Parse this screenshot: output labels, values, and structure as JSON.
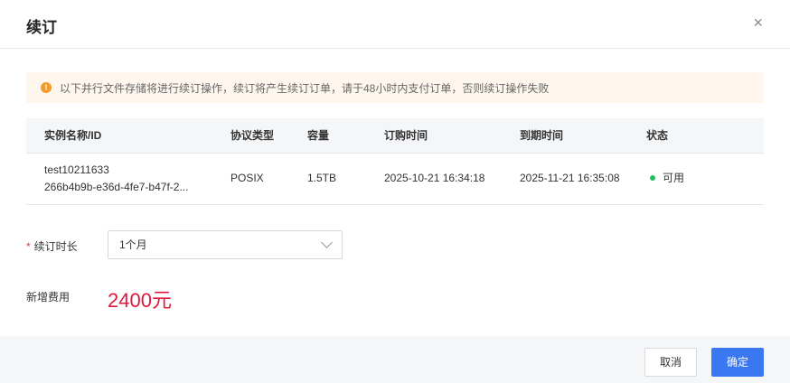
{
  "dialog": {
    "title": "续订",
    "close": "×"
  },
  "alert": {
    "icon": "!",
    "text": "以下并行文件存储将进行续订操作，续订将产生续订订单，请于48小时内支付订单，否则续订操作失败"
  },
  "table": {
    "headers": [
      "实例名称/ID",
      "协议类型",
      "容量",
      "订购时间",
      "到期时间",
      "状态"
    ],
    "rows": [
      {
        "name": "test10211633",
        "id": "266b4b9b-e36d-4fe7-b47f-2...",
        "protocol": "POSIX",
        "capacity": "1.5TB",
        "order_time": "2025-10-21 16:34:18",
        "expire_time": "2025-11-21 16:35:08",
        "status": "可用",
        "status_color": "#1fbf5c"
      }
    ]
  },
  "form": {
    "required_mark": "*",
    "duration_label": "续订时长",
    "duration_value": "1个月",
    "fee_label": "新增费用",
    "fee_value": "2400元"
  },
  "footer": {
    "cancel": "取消",
    "confirm": "确定"
  }
}
